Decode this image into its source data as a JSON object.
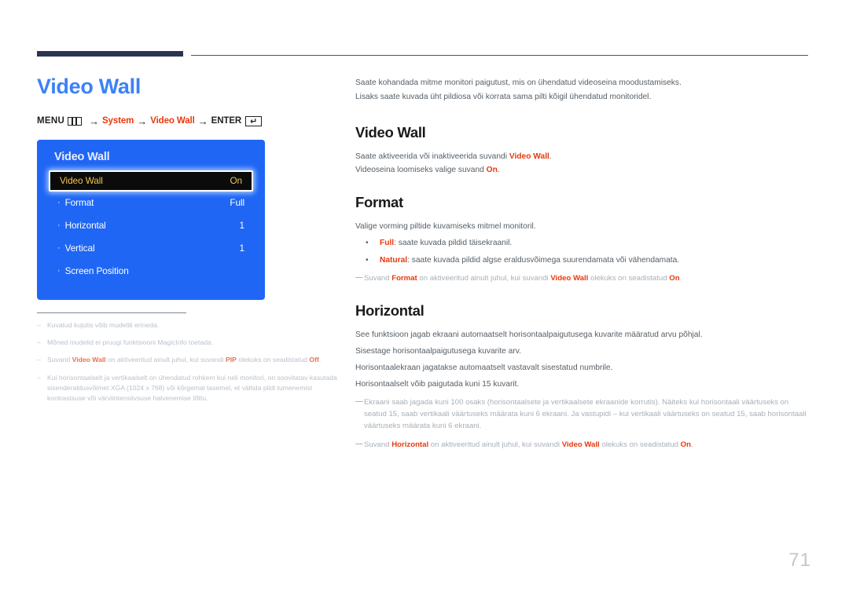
{
  "header": {
    "bar_color": "#2b3550",
    "line_color": "#4a5468"
  },
  "left": {
    "page_title": "Video Wall",
    "breadcrumb": {
      "menu_label": "MENU",
      "menu_icon": "menu-grid-icon",
      "arrow": "→",
      "step1": "System",
      "step2": "Video Wall",
      "enter_label": "ENTER",
      "enter_icon": "enter-key-icon",
      "enter_glyph": "↵",
      "accent_color": "#e8380d"
    },
    "osd": {
      "title": "Video Wall",
      "bg_color": "#1f66f5",
      "highlight_text_color": "#f5c542",
      "rows": [
        {
          "label": "Video Wall",
          "value": "On",
          "highlighted": true,
          "bullet": ""
        },
        {
          "label": "Format",
          "value": "Full",
          "highlighted": false,
          "bullet": "·"
        },
        {
          "label": "Horizontal",
          "value": "1",
          "highlighted": false,
          "bullet": "·"
        },
        {
          "label": "Vertical",
          "value": "1",
          "highlighted": false,
          "bullet": "·"
        },
        {
          "label": "Screen Position",
          "value": "",
          "highlighted": false,
          "bullet": "·"
        }
      ]
    },
    "footnotes": [
      {
        "dash": "–",
        "html": "Kuvatud kujutis võib mudeliti erineda."
      },
      {
        "dash": "–",
        "html": "Mõned mudelid ei pruugi funktsiooni MagicInfo toetada."
      },
      {
        "dash": "–",
        "html": "Suvand <b>Video Wall</b> on aktiveeritud ainult juhul, kui suvandi <b>PIP</b> olekuks on seadistatud <b>Off</b>."
      },
      {
        "dash": "–",
        "html": "Kui horisontaalselt ja vertikaalselt on ühendatud rohkem kui neli monitori, on soovitatav kasutada sisenderaldusvõimet XGA (1024 x 768) või kõrgemal tasemel, et vältida pildi tumenemist kontrastsuse või värviintensiivsuse halvenemise tõttu."
      }
    ]
  },
  "right": {
    "intro": [
      "Saate kohandada mitme monitori paigutust, mis on ühendatud videoseina moodustamiseks.",
      "Lisaks saate kuvada üht pildiosa või korrata sama pilti kõigil ühendatud monitoridel."
    ],
    "sections": [
      {
        "heading": "Video Wall",
        "paragraphs": [
          "Saate aktiveerida või inaktiveerida suvandi <em>Video Wall</em>.",
          "Videoseina loomiseks valige suvand <em>On</em>."
        ],
        "bullets": [],
        "notes": []
      },
      {
        "heading": "Format",
        "paragraphs": [
          "Valige vorming piltide kuvamiseks mitmel monitoril."
        ],
        "bullets": [
          {
            "dot": "•",
            "html": "<strong>Full</strong>: saate kuvada pildid täisekraanil."
          },
          {
            "dot": "•",
            "html": "<strong>Natural</strong>: saate kuvada pildid algse eraldusvõimega suurendamata või vähendamata."
          }
        ],
        "notes": [
          {
            "dash": "—",
            "html": "Suvand <strong>Format</strong> on aktiveeritud ainult juhul, kui suvandi <strong>Video Wall</strong> olekuks on seadistatud <strong>On</strong>."
          }
        ]
      },
      {
        "heading": "Horizontal",
        "paragraphs": [
          "See funktsioon jagab ekraani automaatselt horisontaalpaigutusega kuvarite määratud arvu põhjal.",
          "Sisestage horisontaalpaigutusega kuvarite arv.",
          "Horisontaalekraan jagatakse automaatselt vastavalt sisestatud numbrile.",
          "Horisontaalselt võib paigutada kuni 15 kuvarit."
        ],
        "bullets": [],
        "notes": [
          {
            "dash": "—",
            "html": "Ekraani saab jagada kuni 100 osaks (horisontaalsete ja vertikaalsete ekraanide korrutis). Näiteks kui horisontaali väärtuseks on seatud 15, saab vertikaali väärtuseks määrata kuni 6 ekraani. Ja vastupidi – kui vertikaali väärtuseks on seatud 15, saab horisontaali väärtuseks määrata kuni 6 ekraani."
          },
          {
            "dash": "—",
            "html": "Suvand <strong>Horizontal</strong> on aktiveeritud ainult juhul, kui suvandi <strong>Video Wall</strong> olekuks on seadistatud <strong>On</strong>."
          }
        ]
      }
    ]
  },
  "page_number": "71"
}
